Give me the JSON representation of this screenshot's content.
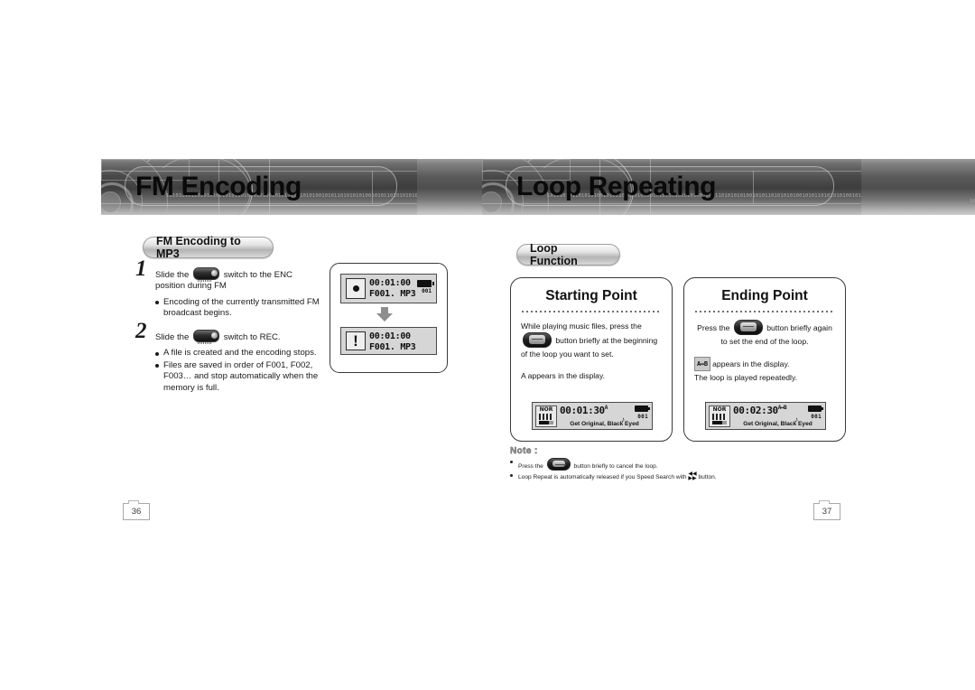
{
  "left_page": {
    "banner_title": "FM Encoding",
    "tab_label": "FM Encoding to MP3",
    "page_number": "36",
    "steps": [
      {
        "number": "1",
        "text_before_icon": "Slide the",
        "icon": "slide-switch-icon",
        "text_after_icon": "switch to the ENC position during FM",
        "bullets": [
          "Encoding of the currently transmitted FM broadcast begins."
        ]
      },
      {
        "number": "2",
        "text_before_icon": "Slide the",
        "icon": "slide-switch-icon",
        "text_after_icon": "switch to REC.",
        "bullets": [
          "A file is created and the encoding stops.",
          "Files are saved in order of F001, F002, F003… and stop automatically when the memory is full."
        ]
      }
    ],
    "lcd_displays": [
      {
        "icon": "record-dot-icon",
        "time": "00:01:00",
        "filename": "F001. MP3",
        "battery": "battery-icon",
        "track_number": "001"
      },
      {
        "icon": "exclamation-icon",
        "time": "00:01:00",
        "filename": "F001. MP3",
        "battery": null,
        "track_number": null
      }
    ],
    "arrow": "arrow-down-icon"
  },
  "right_page": {
    "banner_title": "Loop Repeating",
    "tab_label": "Loop Function",
    "page_number": "37",
    "panels": [
      {
        "id": "starting-point",
        "title": "Starting Point",
        "line1_before": "While playing music files, press the",
        "line1_icon": "play-button-icon",
        "line1_after": "button briefly  at the beginning of the loop you want to set.",
        "line2": "A appears in the display.",
        "lcd": {
          "mode": "NOR",
          "eq": "equalizer-icon",
          "volume": "volume-icon",
          "time": "00:01:30",
          "superscript": "A",
          "note": "music-note-icon",
          "battery": "battery-icon",
          "track_number": "001",
          "track_title": "Get Original, Black Eyed"
        }
      },
      {
        "id": "ending-point",
        "title": "Ending Point",
        "line1_before": "Press the",
        "line1_icon": "play-button-icon",
        "line1_after": "button briefly again to set the end of the loop.",
        "badge": "A↔B",
        "line2": "appears in the display.",
        "line3": "The loop is played repeatedly.",
        "lcd": {
          "mode": "NOR",
          "eq": "equalizer-icon",
          "volume": "volume-icon",
          "time": "00:02:30",
          "superscript": "A↔B",
          "note": "music-note-icon",
          "battery": "battery-icon",
          "track_number": "001",
          "track_title": "Get Original, Black Eyed"
        }
      }
    ],
    "note": {
      "title": "Note :",
      "lines": [
        {
          "before": "Press the",
          "icon": "play-button-icon",
          "after": "button briefly to cancel the loop."
        },
        {
          "before": "Loop Repeat is automatically released if you Speed Search with",
          "icon": "speed-search-icon",
          "after": "button."
        }
      ]
    }
  },
  "binary_texture": "10101010110101010010101101010101001010110101010100101011010101010010101101010101001010110101010100101011010101010010101101010101"
}
